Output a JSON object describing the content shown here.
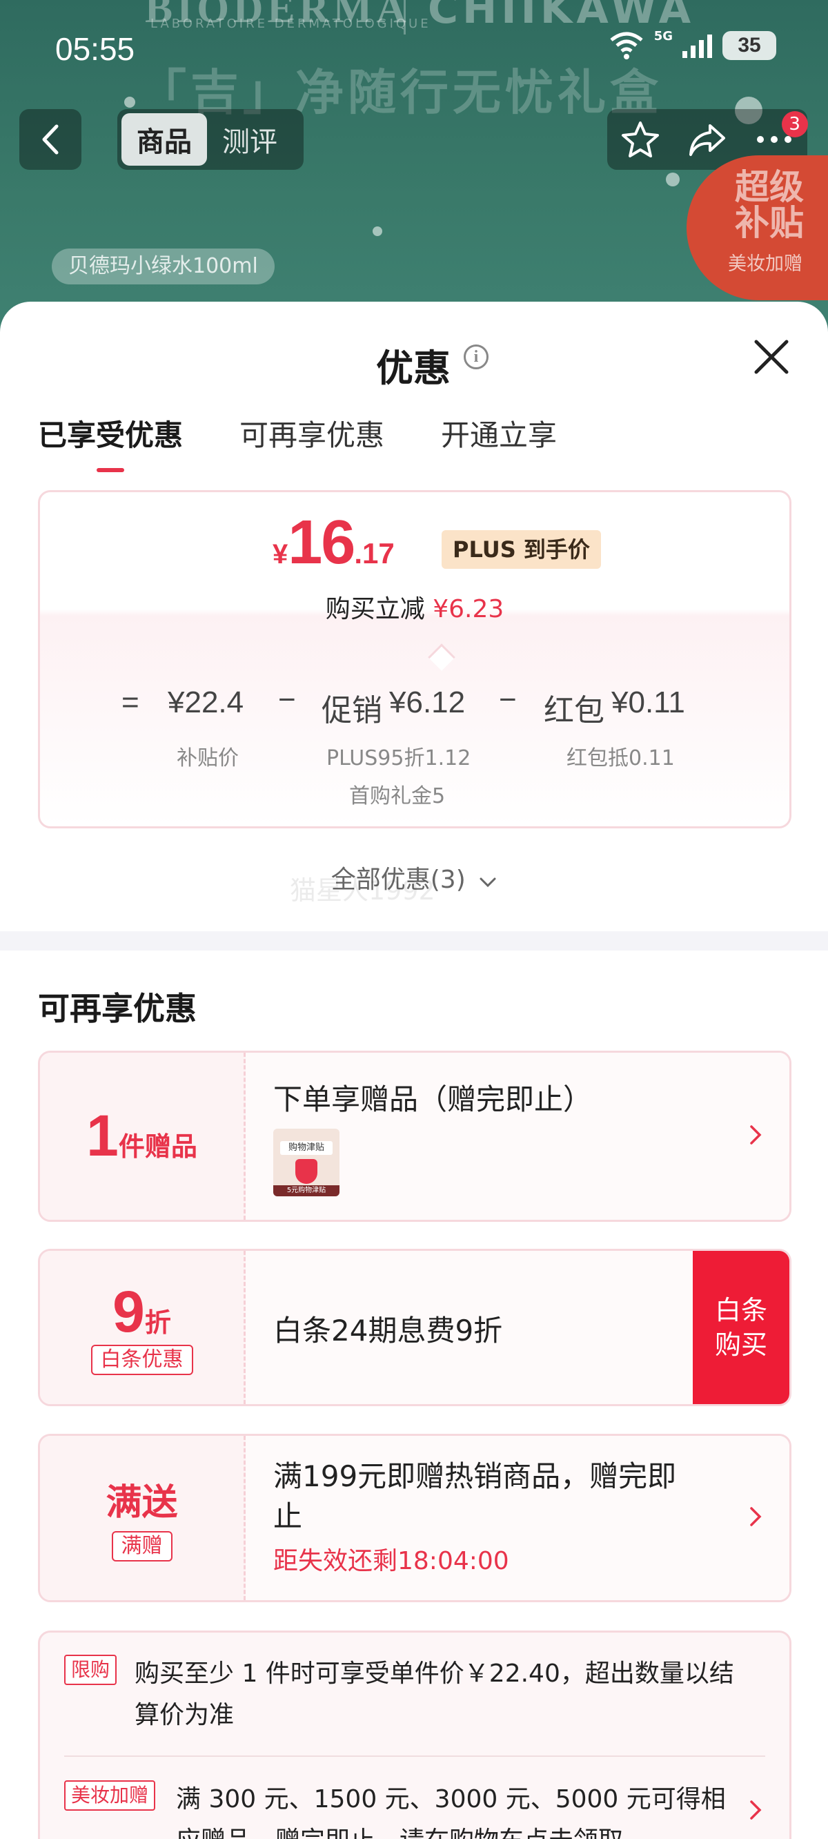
{
  "status_bar": {
    "time": "05:55",
    "network": "5G",
    "wifi_level": "6",
    "battery": "35"
  },
  "background": {
    "brand_left": "BIODERMA",
    "brand_left_sub": "LABORATOIRE DERMATOLOGIQUE",
    "brand_right": "CHIIKAWA",
    "headline": "「吉」净随行无忧礼盒",
    "product_chip": "贝德玛小绿水100ml",
    "subsidy_badge": {
      "big": "超级补贴",
      "small": "美妆加赠"
    }
  },
  "nav": {
    "tabs": [
      {
        "label": "商品",
        "active": true
      },
      {
        "label": "测评",
        "active": false
      }
    ],
    "more_badge": "3"
  },
  "sheet": {
    "title": "优惠",
    "tabs": [
      {
        "label": "已享受优惠",
        "active": true
      },
      {
        "label": "可再享优惠",
        "active": false
      },
      {
        "label": "开通立享",
        "active": false
      }
    ],
    "price": {
      "currency": "¥",
      "integer": "16",
      "decimal": ".17",
      "tag": "PLUS 到手价",
      "reduce_label": "购买立减",
      "reduce_amount": "¥6.23"
    },
    "formula": {
      "eq": "=",
      "base": "¥22.4",
      "minus1": "−",
      "promo_label": "促销",
      "promo_amount": "¥6.12",
      "minus2": "−",
      "red_label": "红包",
      "red_amount": "¥0.11",
      "base_sub": "补贴价",
      "promo_sub1": "PLUS95折1.12",
      "promo_sub2": "首购礼金5",
      "red_sub": "红包抵0.11"
    },
    "all_offers": "全部优惠(3)",
    "watermark": "猫星人1992",
    "section_title": "可再享优惠",
    "offers": [
      {
        "left_big": "1",
        "left_unit": "件赠品",
        "text": "下单享赠品（赠完即止）",
        "thumb_title": "购物津贴",
        "thumb_footer": "5元购物津贴"
      },
      {
        "left_big": "9",
        "left_unit": "折",
        "left_tag": "白条优惠",
        "text": "白条24期息费9折",
        "button_line1": "白条",
        "button_line2": "购买"
      },
      {
        "left_big": "满送",
        "left_tag": "满赠",
        "text_line1": "满199元即赠热销商品，赠完即",
        "text_line2": "止",
        "countdown": "距失效还剩18:04:00"
      }
    ],
    "rules": [
      {
        "tag": "限购",
        "line1": "购买至少 1 件时可享受单件价￥22.40，超出数量以结",
        "line2": "算价为准"
      },
      {
        "tag": "美妆加赠",
        "line1": "满 300 元、1500 元、3000 元、5000 元可得相",
        "line2": "应赠品，赠完即止，请在购物车点击领取"
      }
    ]
  }
}
